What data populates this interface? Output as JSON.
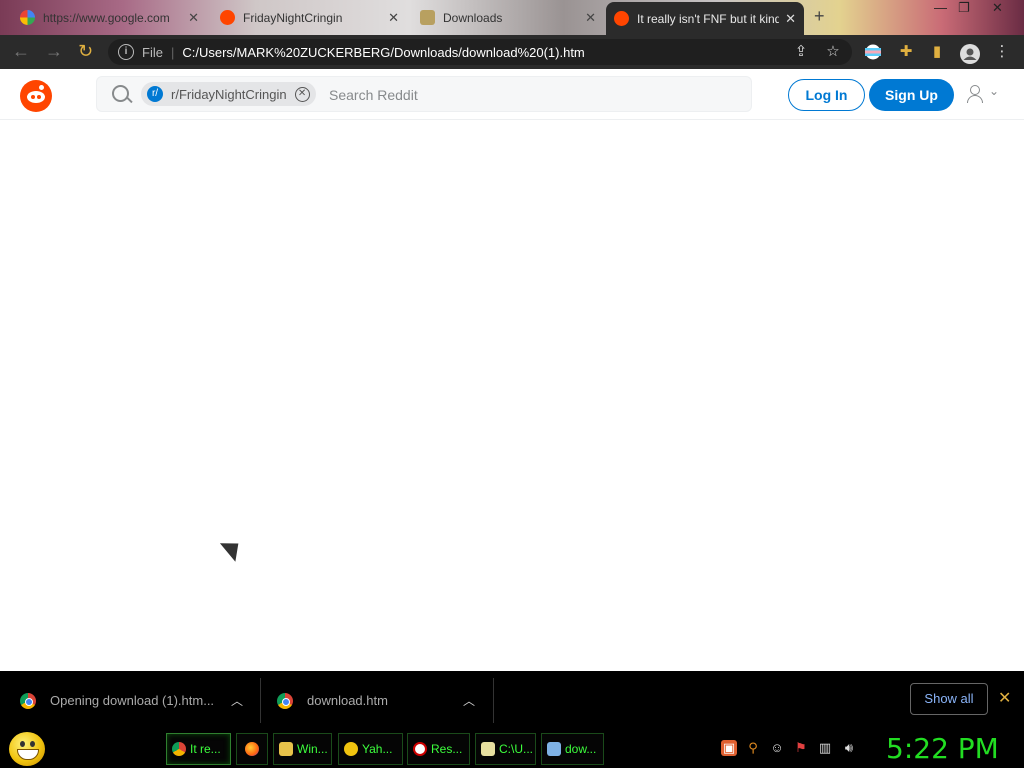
{
  "browser": {
    "tabs": [
      {
        "title": "https://www.google.com",
        "favicon": "google-icon"
      },
      {
        "title": "FridayNightCringin",
        "favicon": "reddit-icon"
      },
      {
        "title": "Downloads",
        "favicon": "downloads-icon"
      },
      {
        "title": "It really isn't FNF but it kinda",
        "favicon": "reddit-icon",
        "active": true
      }
    ],
    "new_tab_label": "+",
    "file_label": "File",
    "url": "C:/Users/MARK%20ZUCKERBERG/Downloads/download%20(1).htm"
  },
  "reddit": {
    "community_chip": "r/FridayNightCringin",
    "community_chip_icon_text": "r/",
    "search_placeholder": "Search Reddit",
    "login_label": "Log In",
    "signup_label": "Sign Up",
    "brand_color": "#ff4500",
    "accent_color": "#0079d3"
  },
  "downloads": {
    "items": [
      {
        "label": "Opening download (1).htm..."
      },
      {
        "label": "download.htm"
      }
    ],
    "show_all_label": "Show all"
  },
  "taskbar": {
    "buttons": [
      {
        "label": "It re...",
        "icon": "chrome-icon"
      },
      {
        "label": "",
        "icon": "firefox-icon"
      },
      {
        "label": "Win...",
        "icon": "folder-icon"
      },
      {
        "label": "Yah...",
        "icon": "yahoo-messenger-icon"
      },
      {
        "label": "Res...",
        "icon": "no-entry-icon"
      },
      {
        "label": "C:\\U...",
        "icon": "notepad-icon"
      },
      {
        "label": "dow...",
        "icon": "image-file-icon"
      }
    ],
    "clock": "5:22 PM"
  }
}
